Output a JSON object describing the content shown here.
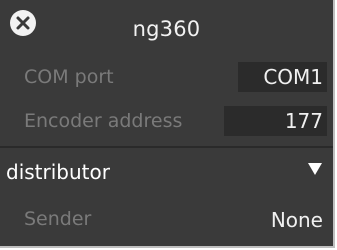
{
  "window": {
    "title": "ng360",
    "close_icon": "close-icon"
  },
  "fields": {
    "com_port": {
      "label": "COM port",
      "value": "COM1"
    },
    "encoder_address": {
      "label": "Encoder address",
      "value": "177"
    }
  },
  "section": {
    "title": "distributor",
    "toggle_icon": "triangle-down-icon"
  },
  "sender": {
    "label": "Sender",
    "value": "None"
  },
  "colors": {
    "panel_bg": "#3a3a3a",
    "field_bg": "#2b2b2b",
    "label_text": "#7a7a7a",
    "value_text": "#f0f0f0"
  }
}
